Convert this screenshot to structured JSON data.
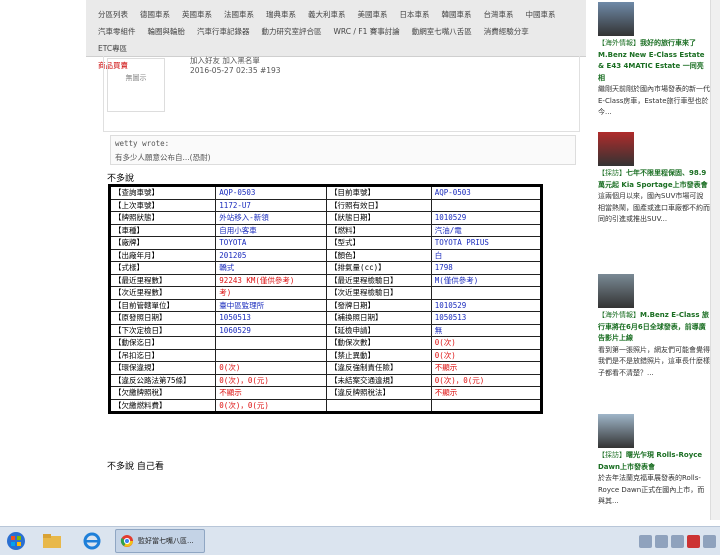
{
  "nav": {
    "row1": [
      "分區列表",
      "德國車系",
      "英國車系",
      "法國車系",
      "瑞典車系",
      "義大利車系",
      "美國車系",
      "日本車系",
      "韓國車系",
      "台灣車系",
      "中國車系"
    ],
    "row2": [
      "汽車零組件",
      "輪圈與輪胎",
      "汽車行車記錄器",
      "動力研究室評合區",
      "WRC / F1 賽事討論",
      "動網室七嘴八舌區",
      "消費經驗分享",
      "ETC專區"
    ],
    "row3": [
      "商品買賣"
    ]
  },
  "post": {
    "avatar_text": "無圖示",
    "actions": "加入好友  加入黑名單",
    "meta": "2016-05-27 02:35  #193"
  },
  "quote": {
    "who": "wetty wrote:",
    "text": "有多少人願意公布自...(恐耐)"
  },
  "intro": "不多說",
  "outro": "不多說 自己看",
  "table": [
    [
      {
        "l": "【查詢車號】"
      },
      {
        "v": "AQP-0503"
      },
      {
        "l": "【目前車號】"
      },
      {
        "v": "AQP-0503"
      }
    ],
    [
      {
        "l": "【上次車號】"
      },
      {
        "v": "1172-U7"
      },
      {
        "l": "【行照有效日】"
      },
      {
        "v": ""
      }
    ],
    [
      {
        "l": "【牌照狀態】"
      },
      {
        "v": "外站移入-新領"
      },
      {
        "l": "【狀態日期】"
      },
      {
        "v": "1010529"
      }
    ],
    [
      {
        "l": "【車種】"
      },
      {
        "v": "自用小客車"
      },
      {
        "l": "【燃料】"
      },
      {
        "v": "汽油/電"
      }
    ],
    [
      {
        "l": "【廠牌】"
      },
      {
        "v": "TOYOTA"
      },
      {
        "l": "【型式】"
      },
      {
        "v": "TOYOTA PRIUS"
      }
    ],
    [
      {
        "l": "【出廠年月】"
      },
      {
        "v": "201205"
      },
      {
        "l": "【顏色】"
      },
      {
        "v": "白"
      }
    ],
    [
      {
        "l": "【式樣】"
      },
      {
        "v": "轎式"
      },
      {
        "l": "【排氣量(cc)】"
      },
      {
        "v": "1798"
      }
    ],
    [
      {
        "l": "【最近里程數】"
      },
      {
        "v": "92243 KM(僅供參考)",
        "red": true
      },
      {
        "l": "【最近里程檢驗日】"
      },
      {
        "v": "M(僅供參考)"
      }
    ],
    [
      {
        "l": "【次近里程數】"
      },
      {
        "v": "考)",
        "red": true
      },
      {
        "l": "【次近里程檢驗日】"
      },
      {
        "v": ""
      }
    ],
    [
      {
        "l": "【目前管轄單位】"
      },
      {
        "v": "臺中區監理所"
      },
      {
        "l": "【發牌日期】"
      },
      {
        "v": "1010529"
      }
    ],
    [
      {
        "l": "【原發照日期】"
      },
      {
        "v": "1050513"
      },
      {
        "l": "【補換照日期】"
      },
      {
        "v": "1050513"
      }
    ],
    [
      {
        "l": "【下次定檢日】"
      },
      {
        "v": "1060529"
      },
      {
        "l": "【延檢申請】"
      },
      {
        "v": "無"
      }
    ],
    [
      {
        "l": "【動保迄日】"
      },
      {
        "v": ""
      },
      {
        "l": "【動保次數】"
      },
      {
        "v": "0(次)",
        "red": true
      }
    ],
    [
      {
        "l": "【吊扣迄日】"
      },
      {
        "v": ""
      },
      {
        "l": "【禁止異動】"
      },
      {
        "v": "0(次)",
        "red": true
      }
    ],
    [
      {
        "l": "【環保違規】"
      },
      {
        "v": "0(次)",
        "red": true
      },
      {
        "l": "【違反強制責任險】"
      },
      {
        "v": "不顯示",
        "red": true
      }
    ],
    [
      {
        "l": "【違反公路法第75條】"
      },
      {
        "v": "0(次)，0(元)",
        "red": true
      },
      {
        "l": "【未結案交通違規】"
      },
      {
        "v": "0(次)，0(元)",
        "red": true
      }
    ],
    [
      {
        "l": "【欠繳牌照稅】"
      },
      {
        "v": "不顯示",
        "red": true
      },
      {
        "l": "【違反牌照稅法】"
      },
      {
        "v": "不顯示",
        "red": true
      }
    ],
    [
      {
        "l": "【欠繳燃料費】"
      },
      {
        "v": "0(次)，0(元)",
        "red": true
      },
      {
        "l": ""
      },
      {
        "v": ""
      }
    ]
  ],
  "sidebar": [
    {
      "tag": "【海外情報】",
      "title": "我好的旅行車來了 M.Benz New E-Class Estate & E43 4MATIC Estate 一同亮相",
      "body": "繼剛天前剛於國內市場發表的新一代E-Class房車，Estate旅行車型也於今..."
    },
    {
      "tag": "【採訪】",
      "title": "七年不限里程保固、98.9萬元起 Kia Sportage上市發表會",
      "body": "這兩個月以來，國內SUV市場可說相當熱鬧，國產或進口車廠都不約而同的引進或推出SUV..."
    },
    {
      "tag": "【海外情報】",
      "title": "M.Benz E-Class 旅行車將在6月6日全球發表，前導廣告影片上線",
      "body": "看到第一張照片，網友們可能會覺得我們是不是放錯照片，這車長什麼樣子都看不清楚？..."
    },
    {
      "tag": "【採訪】",
      "title": "曙光乍現 Rolls-Royce Dawn上市發表會",
      "body": "於去年法蘭克福車展發表的Rolls-Royce Dawn正式在國內上市，而與其..."
    }
  ],
  "taskbar": {
    "task_label": "監好當七嘴八區..."
  },
  "colors": {
    "accent_green": "#1a6e22",
    "value_blue": "#1a2bbd",
    "value_red": "#dd1111"
  }
}
